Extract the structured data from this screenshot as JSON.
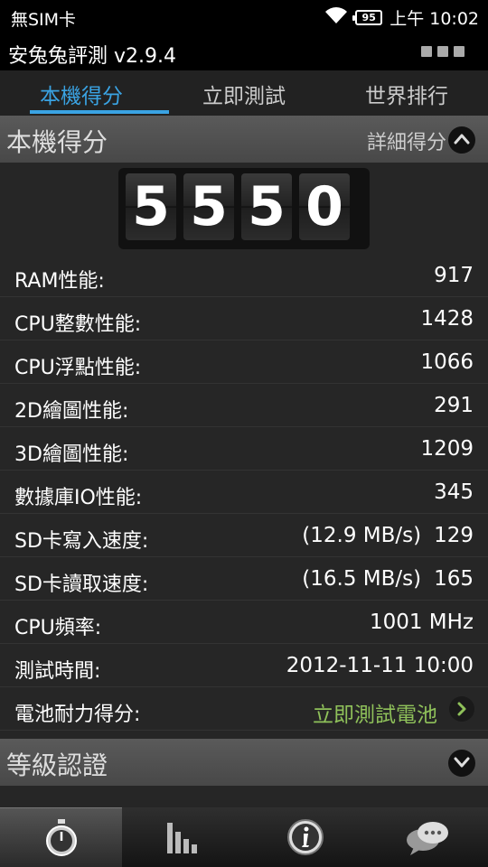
{
  "status_bar": {
    "carrier": "無SIM卡",
    "battery": "95",
    "time": "上午 10:02"
  },
  "app": {
    "title": "安兔兔評測 v2.9.4"
  },
  "tabs": [
    {
      "label": "本機得分",
      "active": true
    },
    {
      "label": "立即測試",
      "active": false
    },
    {
      "label": "世界排行",
      "active": false
    }
  ],
  "score_section": {
    "label": "本機得分",
    "action": "詳細得分"
  },
  "score": {
    "digits": [
      "5",
      "5",
      "5",
      "0"
    ],
    "total": 5550
  },
  "rows": [
    {
      "label": "RAM性能:",
      "value": "917"
    },
    {
      "label": "CPU整數性能:",
      "value": "1428"
    },
    {
      "label": "CPU浮點性能:",
      "value": "1066"
    },
    {
      "label": "2D繪圖性能:",
      "value": "291"
    },
    {
      "label": "3D繪圖性能:",
      "value": "1209"
    },
    {
      "label": "數據庫IO性能:",
      "value": "345"
    },
    {
      "label": "SD卡寫入速度:",
      "speed": "(12.9 MB/s)",
      "value": "129"
    },
    {
      "label": "SD卡讀取速度:",
      "speed": "(16.5 MB/s)",
      "value": "165"
    },
    {
      "label": "CPU頻率:",
      "value": "1001 MHz"
    },
    {
      "label": "測試時間:",
      "value": "2012-11-11 10:00"
    },
    {
      "label": "電池耐力得分:",
      "value": "立即測試電池"
    }
  ],
  "grade_section": {
    "label": "等級認證"
  },
  "bottom_bar": [
    {
      "icon": "stopwatch-icon",
      "active": true
    },
    {
      "icon": "bar-chart-icon",
      "active": false
    },
    {
      "icon": "info-icon",
      "active": false
    },
    {
      "icon": "chat-bubbles-icon",
      "active": false
    }
  ],
  "colors": {
    "accent": "#3aa3e3",
    "link": "#8fc15a"
  }
}
